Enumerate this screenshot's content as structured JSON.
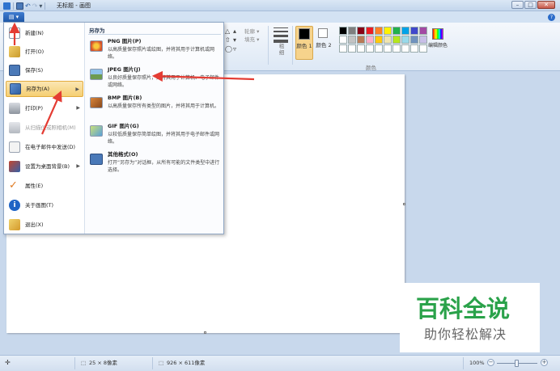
{
  "window": {
    "title": "无标题 - 画图",
    "controls": {
      "minimize": "–",
      "maximize": "□",
      "close": "✕"
    }
  },
  "quick_access": {
    "icons": [
      "paint-app-icon",
      "save-icon",
      "undo-icon",
      "redo-icon"
    ],
    "dropdown": "▾"
  },
  "ribbon": {
    "file_button": "▤ ▾",
    "help": "?",
    "outline_label": "轮廓 ▾",
    "fill_label": "填充 ▾",
    "thickness_label": "粗细",
    "color1_label": "颜色 1",
    "color2_label": "颜色 2",
    "edit_colors_label": "编辑颜色",
    "colors_group_label": "颜色",
    "color1_value": "#000000",
    "color2_value": "#ffffff",
    "palette": [
      "#000000",
      "#7f7f7f",
      "#880015",
      "#ed1c24",
      "#ff7f27",
      "#fff200",
      "#22b14c",
      "#00a2e8",
      "#3f48cc",
      "#a349a4",
      "#ffffff",
      "#c3c3c3",
      "#b97a57",
      "#ffaec9",
      "#ffc90e",
      "#efe4b0",
      "#b5e61d",
      "#99d9ea",
      "#7092be",
      "#c8bfe7",
      "#ffffff",
      "#ffffff",
      "#ffffff",
      "#ffffff",
      "#ffffff",
      "#ffffff",
      "#ffffff",
      "#ffffff",
      "#ffffff",
      "#ffffff"
    ]
  },
  "file_menu": {
    "items": [
      {
        "label": "新建(N)",
        "icon": "new-document-icon"
      },
      {
        "label": "打开(O)",
        "icon": "open-folder-icon"
      },
      {
        "label": "保存(S)",
        "icon": "save-icon"
      },
      {
        "label": "另存为(A)",
        "icon": "save-as-icon",
        "submenu": true,
        "active": true
      },
      {
        "label": "打印(P)",
        "icon": "printer-icon",
        "submenu": true
      },
      {
        "label": "从扫描仪或照相机(M)",
        "icon": "scanner-icon",
        "disabled": true
      },
      {
        "label": "在电子邮件中发送(D)",
        "icon": "email-icon"
      },
      {
        "label": "设置为桌面背景(B)",
        "icon": "desktop-background-icon",
        "submenu": true
      },
      {
        "label": "属性(E)",
        "icon": "properties-check-icon"
      },
      {
        "label": "关于画图(T)",
        "icon": "info-icon"
      },
      {
        "label": "退出(X)",
        "icon": "exit-icon"
      }
    ],
    "submenu_arrow": "▶"
  },
  "save_as_submenu": {
    "title": "另存为",
    "items": [
      {
        "title": "PNG 图片(P)",
        "desc": "以高质量保存照片或绘图，并将其用于计算机或网络。",
        "icon": "png-image-icon"
      },
      {
        "title": "JPEG 图片(J)",
        "desc": "以良好质量保存照片，并将其用于计算机、电子邮件或网络。",
        "icon": "jpeg-image-icon"
      },
      {
        "title": "BMP 图片(B)",
        "desc": "以高质量保存所有类型的图片，并将其用于计算机。",
        "icon": "bmp-image-icon"
      },
      {
        "title": "GIF 图片(G)",
        "desc": "以较低质量保存简单绘图，并将其用于电子邮件或网络。",
        "icon": "gif-image-icon"
      },
      {
        "title": "其他格式(O)",
        "desc": "打开“另存为”对话框，从所有可能的文件类型中进行选择。",
        "icon": "other-formats-icon"
      }
    ]
  },
  "watermark": {
    "title": "百科全说",
    "subtitle": "助你轻松解决"
  },
  "status": {
    "cursor_icon": "✛",
    "selection_size": "25 × 8像素",
    "image_size": "926 × 611像素",
    "zoom": "100%",
    "zoom_out": "−",
    "zoom_in": "+"
  }
}
